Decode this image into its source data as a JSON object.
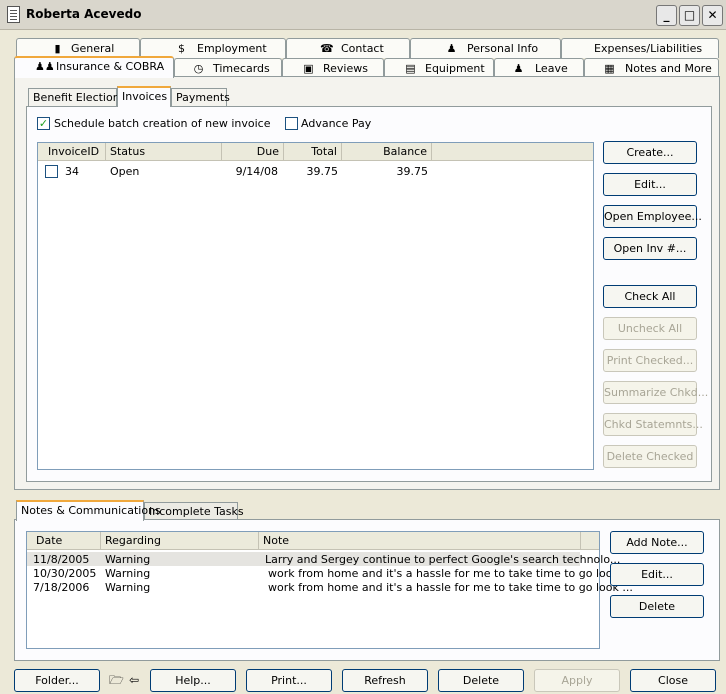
{
  "window": {
    "title": "Roberta Acevedo"
  },
  "outer_tabs_row1": [
    {
      "label": "General",
      "icon": "general-icon"
    },
    {
      "label": "Employment",
      "icon": "dollar-icon"
    },
    {
      "label": "Contact",
      "icon": "phone-icon"
    },
    {
      "label": "Personal Info",
      "icon": "person-icon"
    },
    {
      "label": "Expenses/Liabilities",
      "icon": ""
    }
  ],
  "outer_tabs_row2": [
    {
      "label": "Insurance & COBRA",
      "icon": "family-icon",
      "active": true
    },
    {
      "label": "Timecards",
      "icon": "clock-icon"
    },
    {
      "label": "Reviews",
      "icon": "review-icon"
    },
    {
      "label": "Equipment",
      "icon": "equipment-icon"
    },
    {
      "label": "Leave",
      "icon": "leave-icon"
    },
    {
      "label": "Notes and More",
      "icon": "notes-icon"
    }
  ],
  "inner_tabs": [
    {
      "label": "Benefit Elections"
    },
    {
      "label": "Invoices",
      "active": true
    },
    {
      "label": "Payments"
    }
  ],
  "options": {
    "schedule_batch_label": "Schedule batch creation of new invoice",
    "schedule_batch_checked": true,
    "advance_pay_label": "Advance Pay",
    "advance_pay_checked": false
  },
  "invoices": {
    "columns": [
      "InvoiceID",
      "Status",
      "Due",
      "Total",
      "Balance"
    ],
    "rows": [
      {
        "id": "34",
        "status": "Open",
        "due": "9/14/08",
        "total": "39.75",
        "balance": "39.75",
        "checked": false
      }
    ]
  },
  "invoice_buttons": [
    {
      "label": "Create...",
      "enabled": true
    },
    {
      "label": "Edit...",
      "enabled": true
    },
    {
      "label": "Open Employee...",
      "enabled": true
    },
    {
      "label": "Open Inv #...",
      "enabled": true
    },
    {
      "label": "Check All",
      "enabled": true
    },
    {
      "label": "Uncheck All",
      "enabled": false
    },
    {
      "label": "Print Checked...",
      "enabled": false
    },
    {
      "label": "Summarize Chkd...",
      "enabled": false
    },
    {
      "label": "Chkd Statemnts...",
      "enabled": false
    },
    {
      "label": "Delete Checked",
      "enabled": false
    }
  ],
  "notes_tabs": [
    {
      "label": "Notes & Communications",
      "active": true
    },
    {
      "label": "Incomplete Tasks"
    }
  ],
  "notes": {
    "columns": [
      "Date",
      "Regarding",
      "Note"
    ],
    "rows": [
      {
        "date": "11/8/2005",
        "regarding": "Warning",
        "note": "Larry and Sergey continue to perfect Google's search technolo..."
      },
      {
        "date": "10/30/2005",
        "regarding": "Warning",
        "note": "work from home and it's a hassle for me to take time to go look ..."
      },
      {
        "date": "7/18/2006",
        "regarding": "Warning",
        "note": "work from home and it's a hassle for me to take time to go look ..."
      }
    ]
  },
  "notes_buttons": [
    {
      "label": "Add Note..."
    },
    {
      "label": "Edit..."
    },
    {
      "label": "Delete"
    }
  ],
  "bottom_buttons": {
    "folder": "Folder...",
    "help": "Help...",
    "print": "Print...",
    "refresh": "Refresh",
    "delete": "Delete",
    "apply": "Apply",
    "close": "Close"
  }
}
